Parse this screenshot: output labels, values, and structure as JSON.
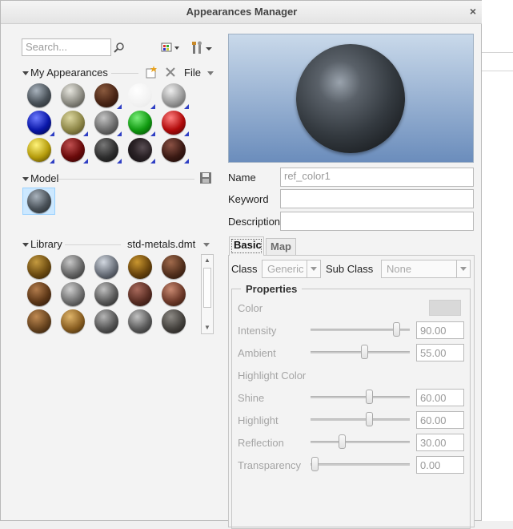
{
  "window": {
    "title": "Appearances Manager",
    "close_glyph": "×"
  },
  "search": {
    "placeholder": "Search..."
  },
  "my_appearances": {
    "label": "My Appearances",
    "file_menu": "File"
  },
  "model": {
    "label": "Model"
  },
  "library": {
    "label": "Library",
    "file": "std-metals.dmt"
  },
  "fields": {
    "name_label": "Name",
    "name_value": "ref_color1",
    "keyword_label": "Keyword",
    "keyword_value": "",
    "description_label": "Description",
    "description_value": ""
  },
  "tabs": {
    "basic": "Basic",
    "map": "Map"
  },
  "class_row": {
    "class_label": "Class",
    "class_value": "Generic",
    "subclass_label": "Sub Class",
    "subclass_value": "None"
  },
  "properties": {
    "group_label": "Properties",
    "color_label": "Color",
    "intensity_label": "Intensity",
    "intensity_value": "90.00",
    "ambient_label": "Ambient",
    "ambient_value": "55.00",
    "highlight_color_label": "Highlight Color",
    "shine_label": "Shine",
    "shine_value": "60.00",
    "highlight_label": "Highlight",
    "highlight_value": "60.00",
    "reflection_label": "Reflection",
    "reflection_value": "30.00",
    "transparency_label": "Transparency",
    "transparency_value": "0.00"
  },
  "colors": {
    "preview_bg_top": "#c9d9ea",
    "preview_bg_bottom": "#6b8dbc",
    "selected_bg": "#cce8ff"
  }
}
